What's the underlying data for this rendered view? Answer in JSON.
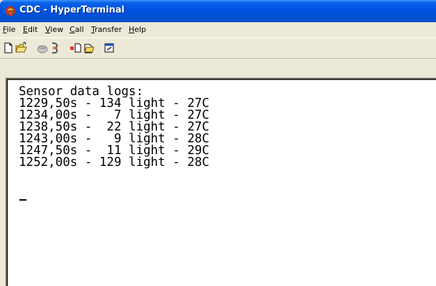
{
  "window": {
    "title": "CDC - HyperTerminal",
    "title_icon": "hyperterminal-phone-icon"
  },
  "menu": [
    {
      "label": "File",
      "mnemonic": "F",
      "rest": "ile"
    },
    {
      "label": "Edit",
      "mnemonic": "E",
      "rest": "dit"
    },
    {
      "label": "View",
      "mnemonic": "V",
      "rest": "iew"
    },
    {
      "label": "Call",
      "mnemonic": "C",
      "rest": "all"
    },
    {
      "label": "Transfer",
      "mnemonic": "T",
      "rest": "ransfer"
    },
    {
      "label": "Help",
      "mnemonic": "H",
      "rest": "elp"
    }
  ],
  "toolbar": {
    "buttons": [
      "new-icon",
      "open-icon",
      "connect-icon",
      "disconnect-icon",
      "send-icon",
      "receive-icon",
      "properties-icon"
    ]
  },
  "terminal": {
    "lines": [
      "Sensor data logs:",
      "1229,50s - 134 light - 27C",
      "1234,00s -   7 light - 27C",
      "1238,50s -  22 light - 27C",
      "1243,00s -   9 light - 28C",
      "1247,50s -  11 light - 29C",
      "1252,00s - 129 light - 28C"
    ]
  },
  "colors": {
    "titlebar": "#0054e3",
    "chrome": "#ece9d8",
    "terminal_bg": "#ffffff",
    "terminal_text": "#000000"
  }
}
